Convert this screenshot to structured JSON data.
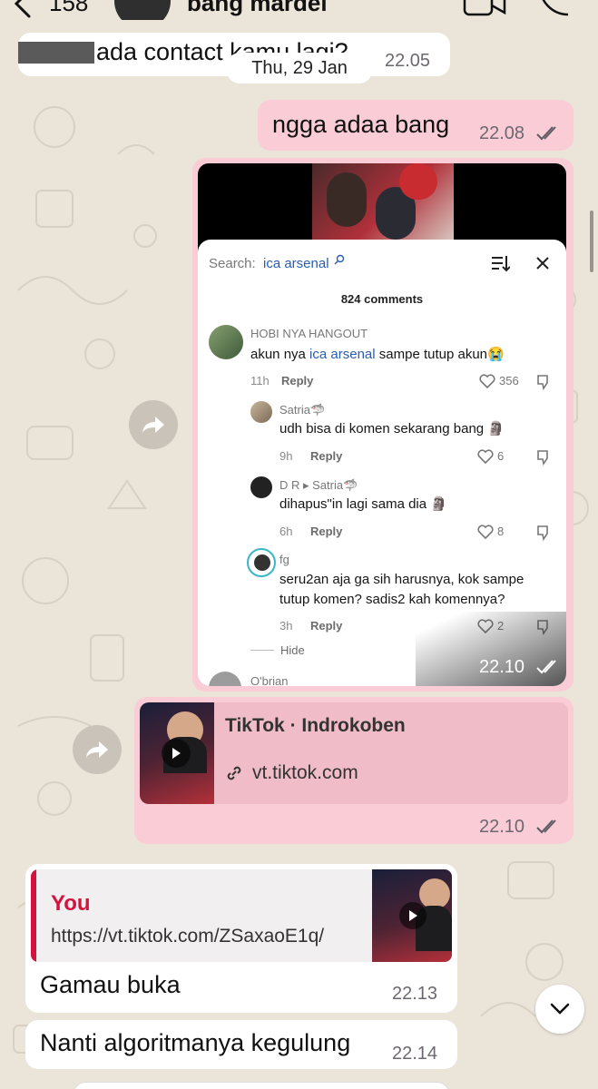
{
  "header": {
    "back_count": "158",
    "contact_name": "bang mardei"
  },
  "date_chip": "Thu, 29 Jan",
  "messages": {
    "m1": {
      "text": "ada contact kamu lagi?",
      "time": "22.05"
    },
    "m2": {
      "text": "ngga adaa bang",
      "time": "22.08"
    },
    "m3": {
      "time": "22.10"
    },
    "m4": {
      "title": "TikTok · Indrokoben",
      "url": "vt.tiktok.com",
      "time": "22.10"
    },
    "m5": {
      "quote_author": "You",
      "quote_url": "https://vt.tiktok.com/ZSaxaoE1q/",
      "text": "Gamau buka",
      "time": "22.13"
    },
    "m6": {
      "text": "Nanti algoritmanya kegulung",
      "time": "22.14"
    }
  },
  "tiktok": {
    "search_label": "Search:",
    "search_query": "ica arsenal",
    "comment_count": "824 comments",
    "comments": [
      {
        "user": "HOBI NYA HANGOUT",
        "text_a": "akun nya ",
        "link": "ica arsenal",
        "text_b": " sampe tutup akun😭",
        "age": "11h",
        "reply": "Reply",
        "likes": "356"
      },
      {
        "user": "Satria🦈",
        "text": "udh bisa di komen sekarang bang 🗿",
        "age": "9h",
        "reply": "Reply",
        "likes": "6"
      },
      {
        "user": "D R ▸ Satria🦈",
        "text": "dihapus\"in lagi sama dia 🗿",
        "age": "6h",
        "reply": "Reply",
        "likes": "8"
      },
      {
        "user": "fg",
        "text": "seru2an aja ga sih harusnya, kok sampe tutup komen? sadis2 kah komennya?",
        "age": "3h",
        "reply": "Reply",
        "likes": "2"
      }
    ],
    "hide_label": "Hide",
    "next_user": "O'brian"
  },
  "colors": {
    "out_bubble": "#f9ccd6",
    "in_bubble": "#ffffff",
    "quote_accent": "#d3123f",
    "wallpaper": "#eae4d9",
    "read_ticks": "#5e5a62"
  }
}
